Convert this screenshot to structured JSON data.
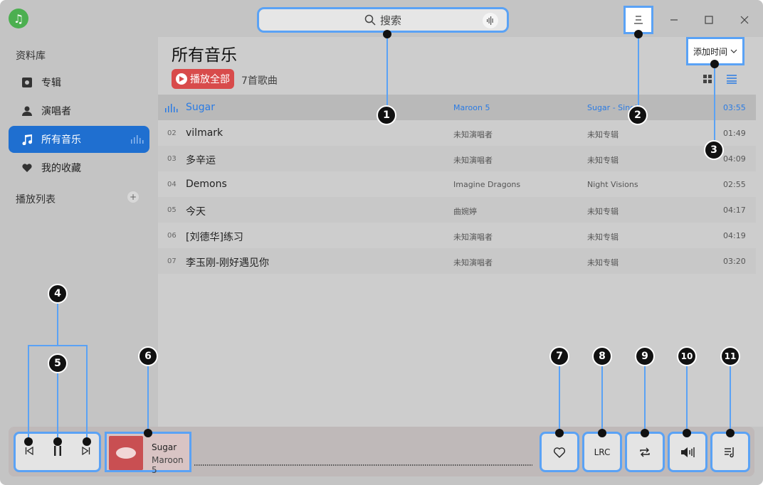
{
  "search": {
    "placeholder": "搜索"
  },
  "sidebar": {
    "library_heading": "资料库",
    "items": [
      {
        "label": "专辑",
        "icon": "album-icon"
      },
      {
        "label": "演唱者",
        "icon": "person-icon"
      },
      {
        "label": "所有音乐",
        "icon": "music-note-icon"
      },
      {
        "label": "我的收藏",
        "icon": "heart-icon"
      }
    ],
    "playlist_heading": "播放列表"
  },
  "main": {
    "title": "所有音乐",
    "play_all_label": "播放全部",
    "song_count": "7首歌曲",
    "sort_label": "添加时间"
  },
  "tracks": [
    {
      "num": "",
      "title": "Sugar",
      "artist": "Maroon 5",
      "album": "Sugar - Single",
      "duration": "03:55"
    },
    {
      "num": "02",
      "title": "vilmark",
      "artist": "未知演唱者",
      "album": "未知专辑",
      "duration": "01:49"
    },
    {
      "num": "03",
      "title": "多辛运",
      "artist": "未知演唱者",
      "album": "未知专辑",
      "duration": "04:09"
    },
    {
      "num": "04",
      "title": "Demons",
      "artist": "Imagine Dragons",
      "album": "Night Visions",
      "duration": "02:55"
    },
    {
      "num": "05",
      "title": "今天",
      "artist": "曲婉婷",
      "album": "未知专辑",
      "duration": "04:17"
    },
    {
      "num": "06",
      "title": "[刘德华]练习",
      "artist": "未知演唱者",
      "album": "未知专辑",
      "duration": "04:19"
    },
    {
      "num": "07",
      "title": "李玉刚-刚好遇见你",
      "artist": "未知演唱者",
      "album": "未知专辑",
      "duration": "03:20"
    }
  ],
  "player": {
    "now_title": "Sugar",
    "now_artist": "Maroon 5",
    "lrc_label": "LRC"
  },
  "callouts": [
    "1",
    "2",
    "3",
    "4",
    "5",
    "6",
    "7",
    "8",
    "9",
    "10",
    "11"
  ],
  "colors": {
    "accent": "#2a7be4",
    "highlight_border": "#5aa2f5",
    "play_all": "#d84b4b"
  }
}
